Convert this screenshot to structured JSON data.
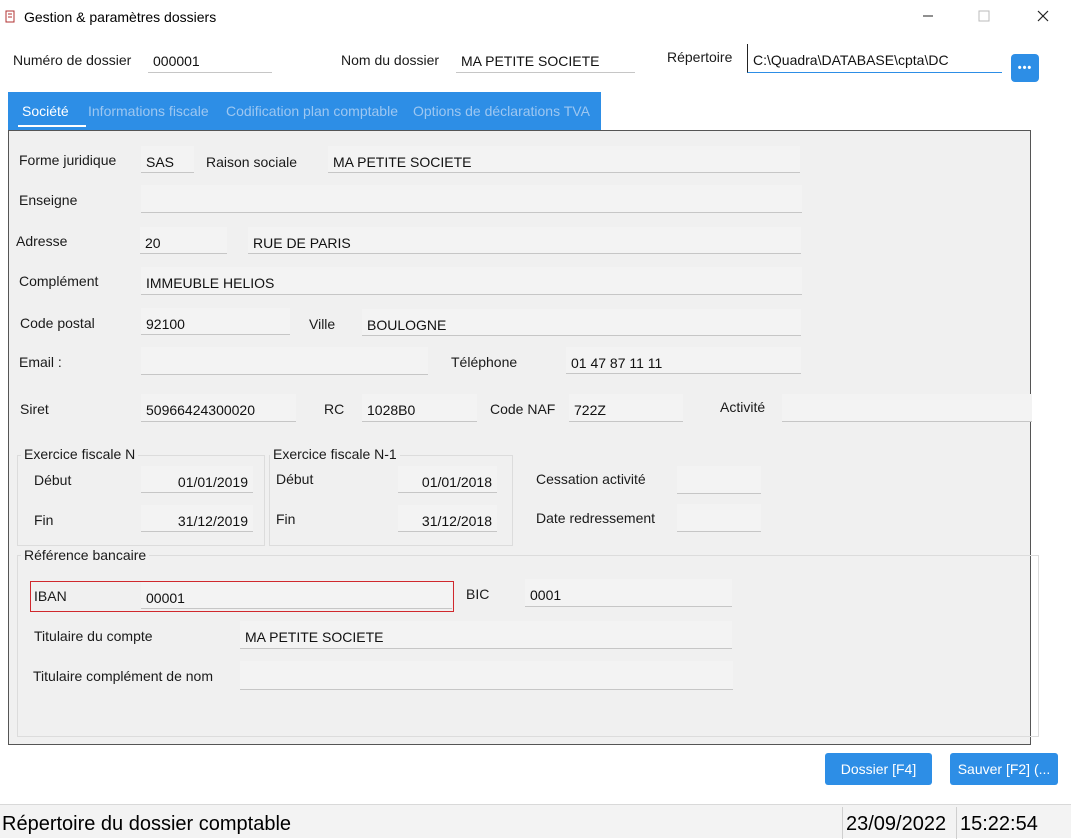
{
  "window": {
    "title": "Gestion & paramètres dossiers",
    "controls": {
      "minimize": "—",
      "maximize": "☐",
      "close": "✕"
    }
  },
  "header": {
    "numero_label": "Numéro de dossier",
    "numero_value": "000001",
    "nom_label": "Nom du dossier",
    "nom_value": "MA PETITE SOCIETE",
    "repertoire_label": "Répertoire",
    "repertoire_value": "C:\\Quadra\\DATABASE\\cpta\\DC",
    "browse_label": "•••"
  },
  "tabs": [
    {
      "label": "Société"
    },
    {
      "label": "Informations fiscale"
    },
    {
      "label": "Codification plan comptable"
    },
    {
      "label": "Options de déclarations TVA"
    }
  ],
  "societe": {
    "forme_label": "Forme juridique",
    "forme_value": "SAS",
    "raison_label": "Raison sociale",
    "raison_value": "MA PETITE SOCIETE",
    "enseigne_label": "Enseigne",
    "enseigne_value": "",
    "adresse_label": "Adresse",
    "adresse_num": "20",
    "adresse_rue": "RUE DE PARIS",
    "complement_label": "Complément",
    "complement_value": "IMMEUBLE HELIOS",
    "cp_label": "Code postal",
    "cp_value": "92100",
    "ville_label": "Ville",
    "ville_value": "BOULOGNE",
    "email_label": "Email :",
    "email_value": "",
    "tel_label": "Téléphone",
    "tel_value": "01 47 87 11 11",
    "siret_label": "Siret",
    "siret_value": "50966424300020",
    "rc_label": "RC",
    "rc_value": "1028B0",
    "naf_label": "Code NAF",
    "naf_value": "722Z",
    "activite_label": "Activité",
    "activite_value": ""
  },
  "exercice_n": {
    "title": "Exercice fiscale N",
    "debut_label": "Début",
    "debut_value": "01/01/2019",
    "fin_label": "Fin",
    "fin_value": "31/12/2019"
  },
  "exercice_n1": {
    "title": "Exercice fiscale N-1",
    "debut_label": "Début",
    "debut_value": "01/01/2018",
    "fin_label": "Fin",
    "fin_value": "31/12/2018"
  },
  "cessation": {
    "cessation_label": "Cessation activité",
    "cessation_value": "",
    "redressement_label": "Date redressement",
    "redressement_value": ""
  },
  "banque": {
    "title": "Référence bancaire",
    "iban_label": "IBAN",
    "iban_value": "00001",
    "bic_label": "BIC",
    "bic_value": "0001",
    "titulaire_label": "Titulaire du compte",
    "titulaire_value": "MA PETITE SOCIETE",
    "complement_label": "Titulaire complément de nom",
    "complement_value": ""
  },
  "buttons": {
    "dossier": "Dossier [F4]",
    "sauver": "Sauver [F2] (..."
  },
  "status": {
    "message": "Répertoire du dossier comptable",
    "date": "23/09/2022",
    "time": "15:22:54"
  },
  "colors": {
    "accent": "#2d8ee6",
    "panel_bg": "#f0f0f0",
    "error_border": "#d0282d"
  }
}
